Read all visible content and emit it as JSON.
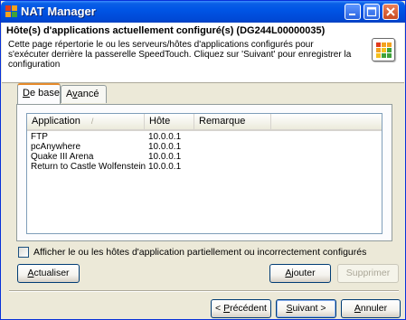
{
  "window": {
    "title": "NAT Manager",
    "colors": {
      "titlebar": "#0055e5",
      "face": "#ece9d8",
      "tab_accent": "#e68b2c"
    }
  },
  "header": {
    "title": "Hôte(s) d'applications actuellement configuré(s) (DG244L00000035)",
    "description": "Cette page répertorie le ou les serveurs/hôtes d'applications configurés pour s'exécuter derrière la passerelle SpeedTouch. Cliquez sur 'Suivant' pour enregistrer la configuration"
  },
  "tabs": [
    {
      "label": "De base",
      "mnemonic": "D",
      "rest": "e base",
      "active": true
    },
    {
      "label": "Avancé",
      "pre": "A",
      "mnemonic": "v",
      "rest": "ancé",
      "active": false
    }
  ],
  "list": {
    "columns": [
      "Application",
      "Hôte",
      "Remarque"
    ],
    "sort_icon": "sort-up-icon",
    "rows": [
      {
        "application": "FTP",
        "host": "10.0.0.1",
        "remark": ""
      },
      {
        "application": "pcAnywhere",
        "host": "10.0.0.1",
        "remark": ""
      },
      {
        "application": "Quake III Arena",
        "host": "10.0.0.1",
        "remark": ""
      },
      {
        "application": "Return to Castle Wolfenstein",
        "host": "10.0.0.1",
        "remark": ""
      }
    ]
  },
  "checkbox": {
    "label": "Afficher le ou les hôtes d'application partiellement ou incorrectement configurés",
    "checked": false
  },
  "buttons": {
    "refresh": {
      "mnemonic": "A",
      "rest": "ctualiser"
    },
    "add": {
      "mnemonic": "A",
      "rest": "jouter"
    },
    "delete": {
      "label": "Supprimer",
      "enabled": false
    },
    "back": {
      "prefix": "< ",
      "mnemonic": "P",
      "rest": "récédent"
    },
    "next": {
      "mnemonic": "S",
      "rest": "uivant >"
    },
    "cancel": {
      "mnemonic": "A",
      "rest": "nnuler"
    }
  }
}
